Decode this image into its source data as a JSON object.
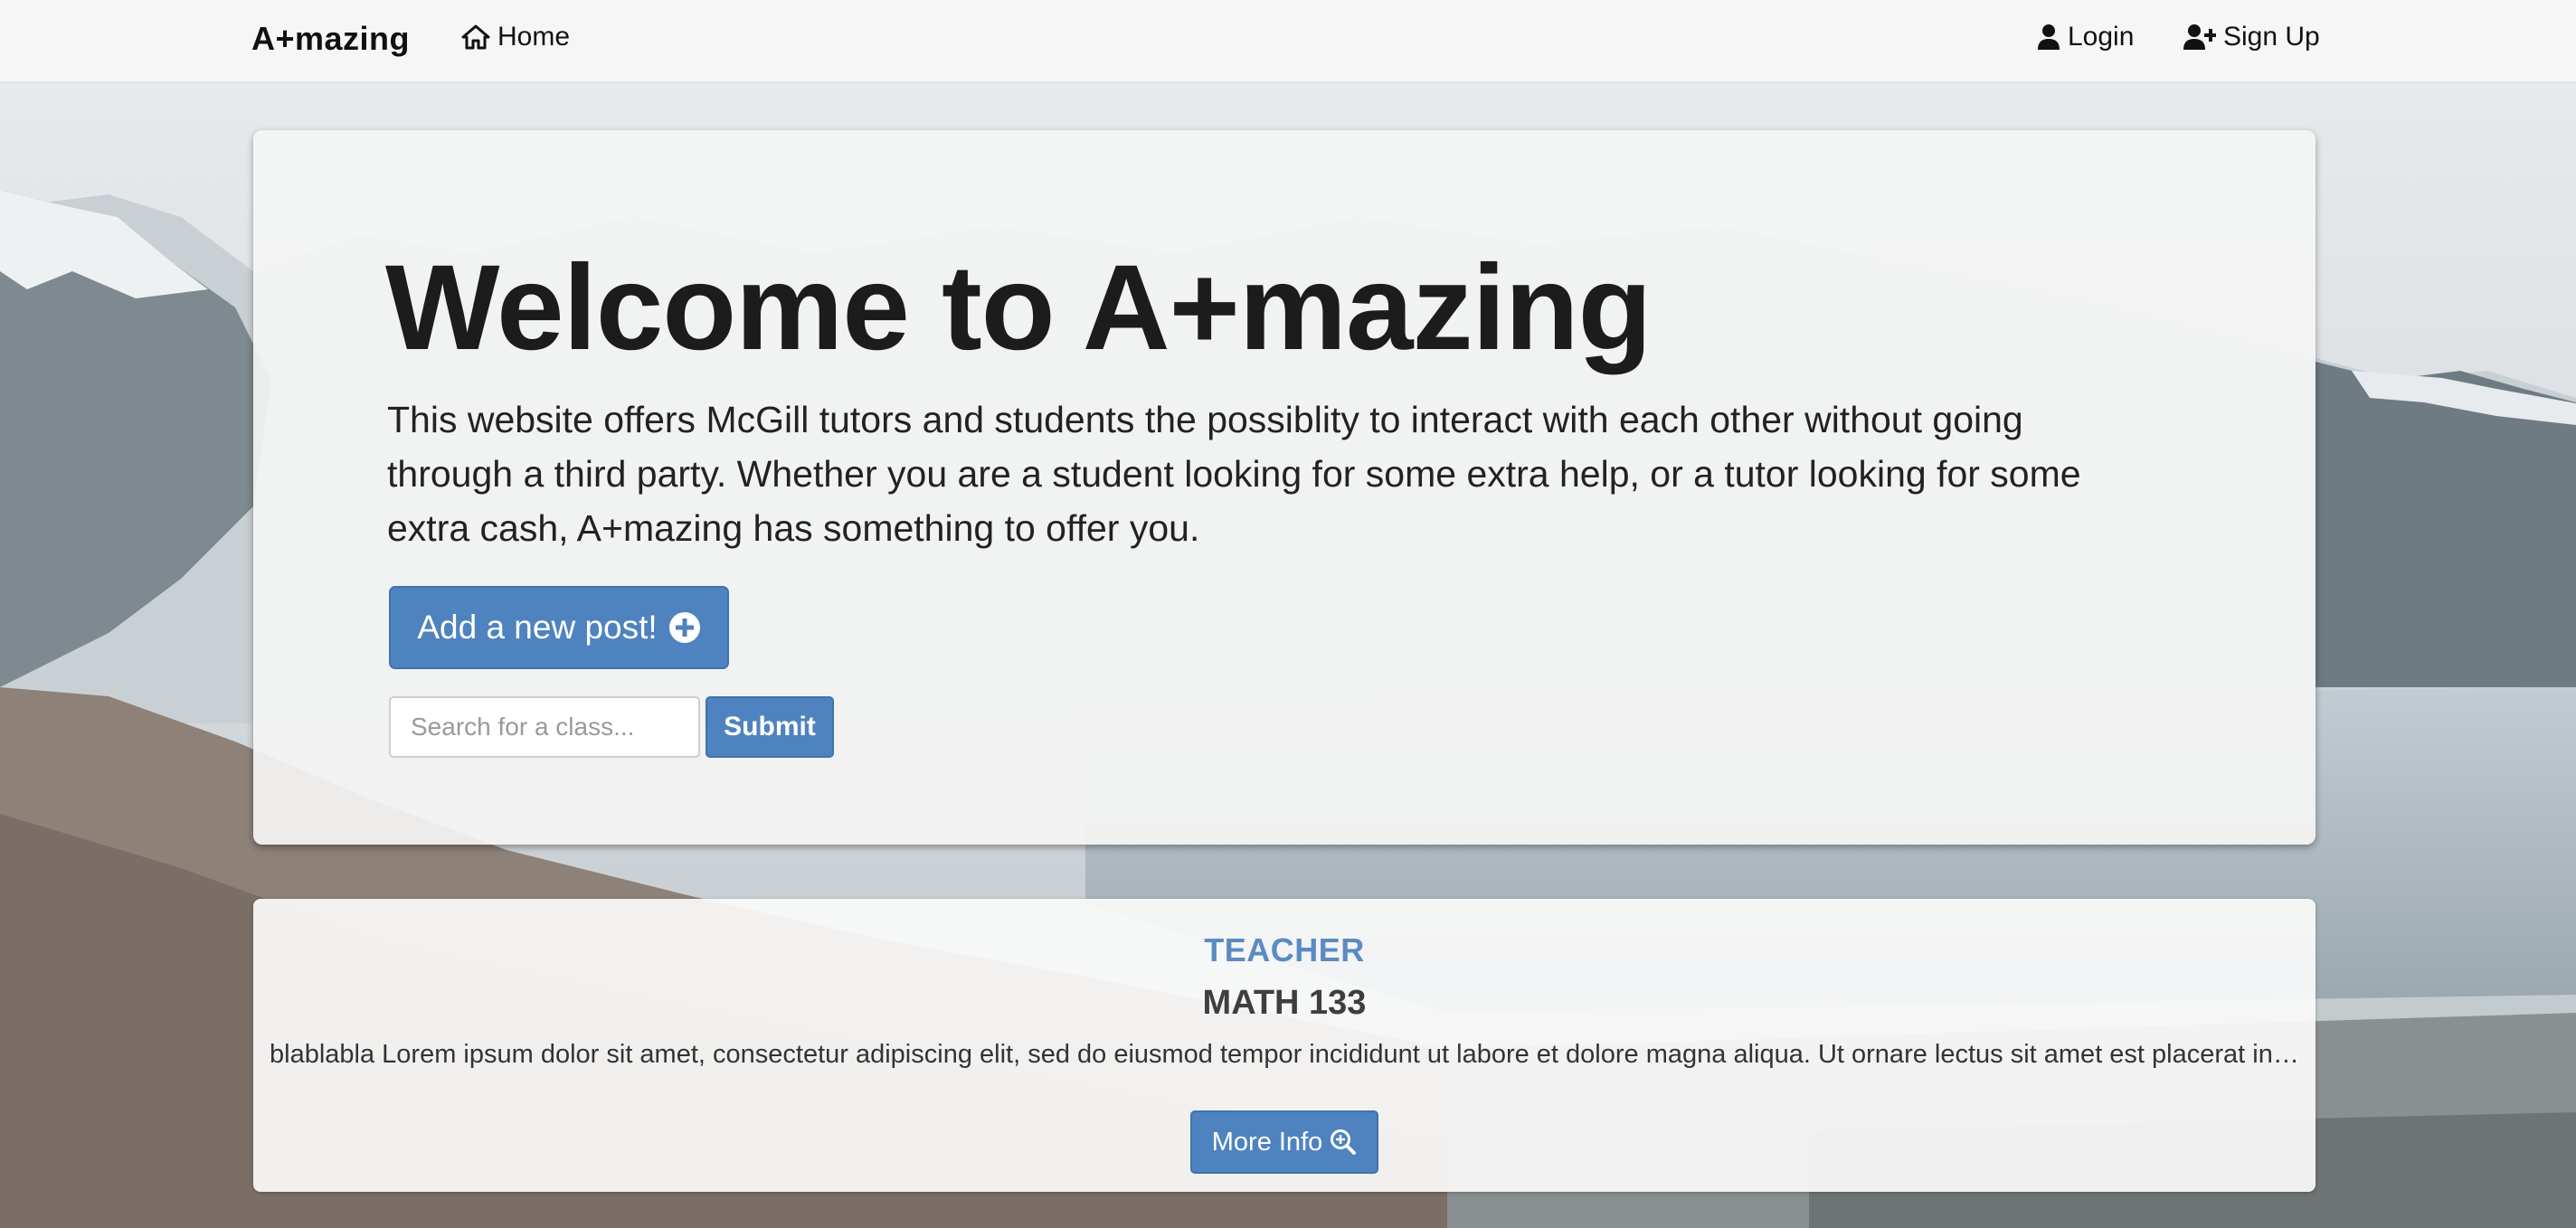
{
  "navbar": {
    "brand": "A+mazing",
    "home_label": "Home",
    "home_icon": "home-icon",
    "login_label": "Login",
    "login_icon": "user-icon",
    "signup_label": "Sign Up",
    "signup_icon": "user-plus-icon"
  },
  "jumbotron": {
    "title": "Welcome to A+mazing",
    "description": "This website offers McGill tutors and students the possiblity to interact with each other without going through a third party. Whether you are a student looking for some extra help, or a tutor looking for some extra cash, A+mazing has something to offer you.",
    "add_post_label": "Add a new post!",
    "add_post_icon": "plus-circle-icon",
    "search_placeholder": "Search for a class...",
    "search_value": "",
    "submit_label": "Submit"
  },
  "posts": [
    {
      "role": "TEACHER",
      "class_name": "MATH 133",
      "description": "blablabla Lorem ipsum dolor sit amet, consectetur adipiscing elit, sed do eiusmod tempor incididunt ut labore et dolore magna aliqua. Ut ornare lectus sit amet est placerat in egestas erat imperdiet sed euismod nisi porta lorem mollis aliquam.",
      "more_info_label": "More Info",
      "more_info_icon": "search-plus-icon"
    }
  ],
  "colors": {
    "primary": "#4f83bf",
    "role_text": "#5a8bc3",
    "navbar_bg": "#f6f6f6"
  }
}
